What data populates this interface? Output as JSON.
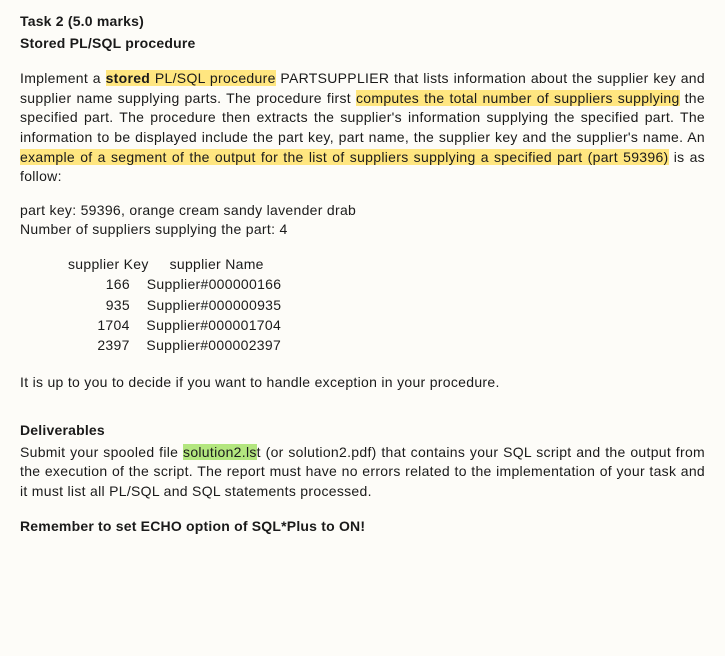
{
  "task": {
    "title": "Task 2 (5.0 marks)",
    "subtitle": "Stored PL/SQL procedure"
  },
  "intro": {
    "pre1": "Implement a ",
    "hl_stored": "stored",
    "mid1": " PL/SQL procedure",
    "post1": " PARTSUPPLIE",
    "post1b": "R that lists information about the supplier key and supplier name supplying parts. The procedure first ",
    "hl_computes": "computes the total number of suppliers supplying",
    "post2": " the specified part. The procedure then extracts the supplier's information supplying the specified part. The information to be displayed include the part key, part name, the supplier key and the supplier's name. An ",
    "hl_example": "example of a segment of the output for the list of suppliers supplying a specified part (part 59396)",
    "post3": " is as follow:"
  },
  "output": {
    "line1": "part key: 59396, orange cream sandy lavender drab",
    "line2": "Number of suppliers supplying the part: 4"
  },
  "table": {
    "header": "supplier Key     supplier Name",
    "r1": "         166    Supplier#000000166",
    "r2": "         935    Supplier#000000935",
    "r3": "       1704    Supplier#000001704",
    "r4": "       2397    Supplier#000002397"
  },
  "exception_note": "It is up to you to decide if you want to handle exception in your procedure.",
  "deliverables": {
    "heading": "Deliverables",
    "pre": "Submit your spooled file ",
    "hl_file": "solution2.ls",
    "post": "t (or solution2.pdf) that contains your SQL script and the output from the execution of the script. The report must have no errors related to the implementation of your task and it must list all PL/SQL and SQL statements processed."
  },
  "remember": "Remember to set ECHO option of SQL*Plus to ON!"
}
